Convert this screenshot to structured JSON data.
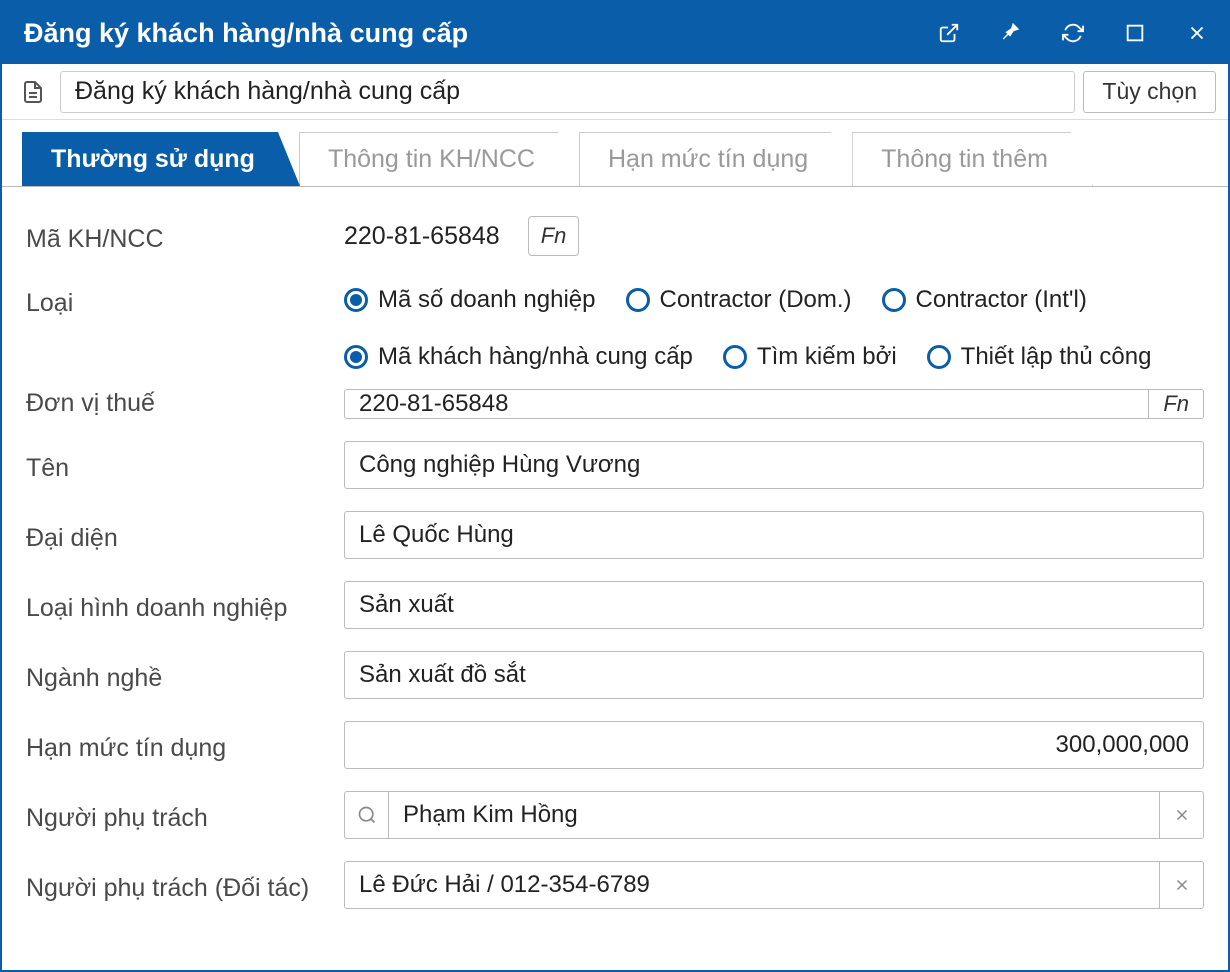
{
  "titlebar": {
    "title": "Đăng ký khách hàng/nhà cung cấp"
  },
  "toolbar": {
    "path": "Đăng ký khách hàng/nhà cung cấp",
    "option_label": "Tùy chọn"
  },
  "tabs": [
    {
      "label": "Thường sử dụng",
      "active": true
    },
    {
      "label": "Thông tin KH/NCC",
      "active": false
    },
    {
      "label": "Hạn mức tín dụng",
      "active": false
    },
    {
      "label": "Thông tin thêm",
      "active": false
    }
  ],
  "form": {
    "code_label": "Mã KH/NCC",
    "code_value": "220-81-65848",
    "fn_label": "Fn",
    "type_label": "Loại",
    "type_options": [
      {
        "label": "Mã số doanh nghiệp",
        "checked": true
      },
      {
        "label": "Contractor (Dom.)",
        "checked": false
      },
      {
        "label": "Contractor (Int'l)",
        "checked": false
      }
    ],
    "tax_label": "Đơn vị thuế",
    "tax_options": [
      {
        "label": "Mã khách hàng/nhà cung cấp",
        "checked": true
      },
      {
        "label": "Tìm kiếm bởi",
        "checked": false
      },
      {
        "label": "Thiết lập thủ công",
        "checked": false
      }
    ],
    "tax_value": "220-81-65848",
    "name_label": "Tên",
    "name_value": "Công nghiệp Hùng Vương",
    "rep_label": "Đại diện",
    "rep_value": "Lê Quốc Hùng",
    "biztype_label": "Loại hình doanh nghiệp",
    "biztype_value": "Sản xuất",
    "industry_label": "Ngành nghề",
    "industry_value": "Sản xuất đồ sắt",
    "credit_label": "Hạn mức tín dụng",
    "credit_value": "300,000,000",
    "manager_label": "Người phụ trách",
    "manager_value": "Phạm Kim Hồng",
    "partner_label": "Người phụ trách (Đối tác)",
    "partner_value": "Lê Đức Hải / 012-354-6789"
  }
}
